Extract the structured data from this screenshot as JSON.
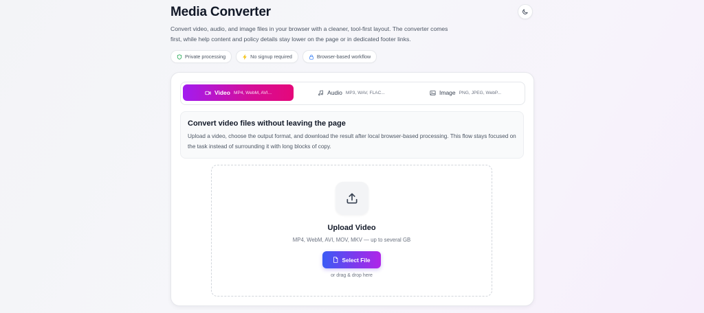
{
  "header": {
    "title": "Media Converter",
    "description": "Convert video, audio, and image files in your browser with a cleaner, tool-first layout. The converter comes first, while help content and policy details stay lower on the page or in dedicated footer links."
  },
  "chips": [
    {
      "label": "Private processing",
      "icon": "shield-icon",
      "color": "#16a34a"
    },
    {
      "label": "No signup required",
      "icon": "bolt-icon",
      "color": "#eab308"
    },
    {
      "label": "Browser-based workflow",
      "icon": "lock-icon",
      "color": "#3b82f6"
    }
  ],
  "theme_toggle": {
    "icon": "moon-icon"
  },
  "tabs": [
    {
      "label": "Video",
      "formats": "MP4, WebM, AVI...",
      "icon": "video-icon",
      "active": true
    },
    {
      "label": "Audio",
      "formats": "MP3, WAV, FLAC...",
      "icon": "music-icon",
      "active": false
    },
    {
      "label": "Image",
      "formats": "PNG, JPEG, WebP...",
      "icon": "image-icon",
      "active": false
    }
  ],
  "info": {
    "heading": "Convert video files without leaving the page",
    "body": "Upload a video, choose the output format, and download the result after local browser-based processing. This flow stays focused on the task instead of surrounding it with long blocks of copy."
  },
  "upload": {
    "title": "Upload Video",
    "subtitle": "MP4, WebM, AVI, MOV, MKV — up to several GB",
    "button_label": "Select File",
    "drag_hint": "or drag & drop here"
  },
  "colors": {
    "accent_gradient_start": "#a21cf0",
    "accent_gradient_end": "#e5087a",
    "button_gradient_start": "#3b5bf5",
    "button_gradient_end": "#b026e8"
  }
}
